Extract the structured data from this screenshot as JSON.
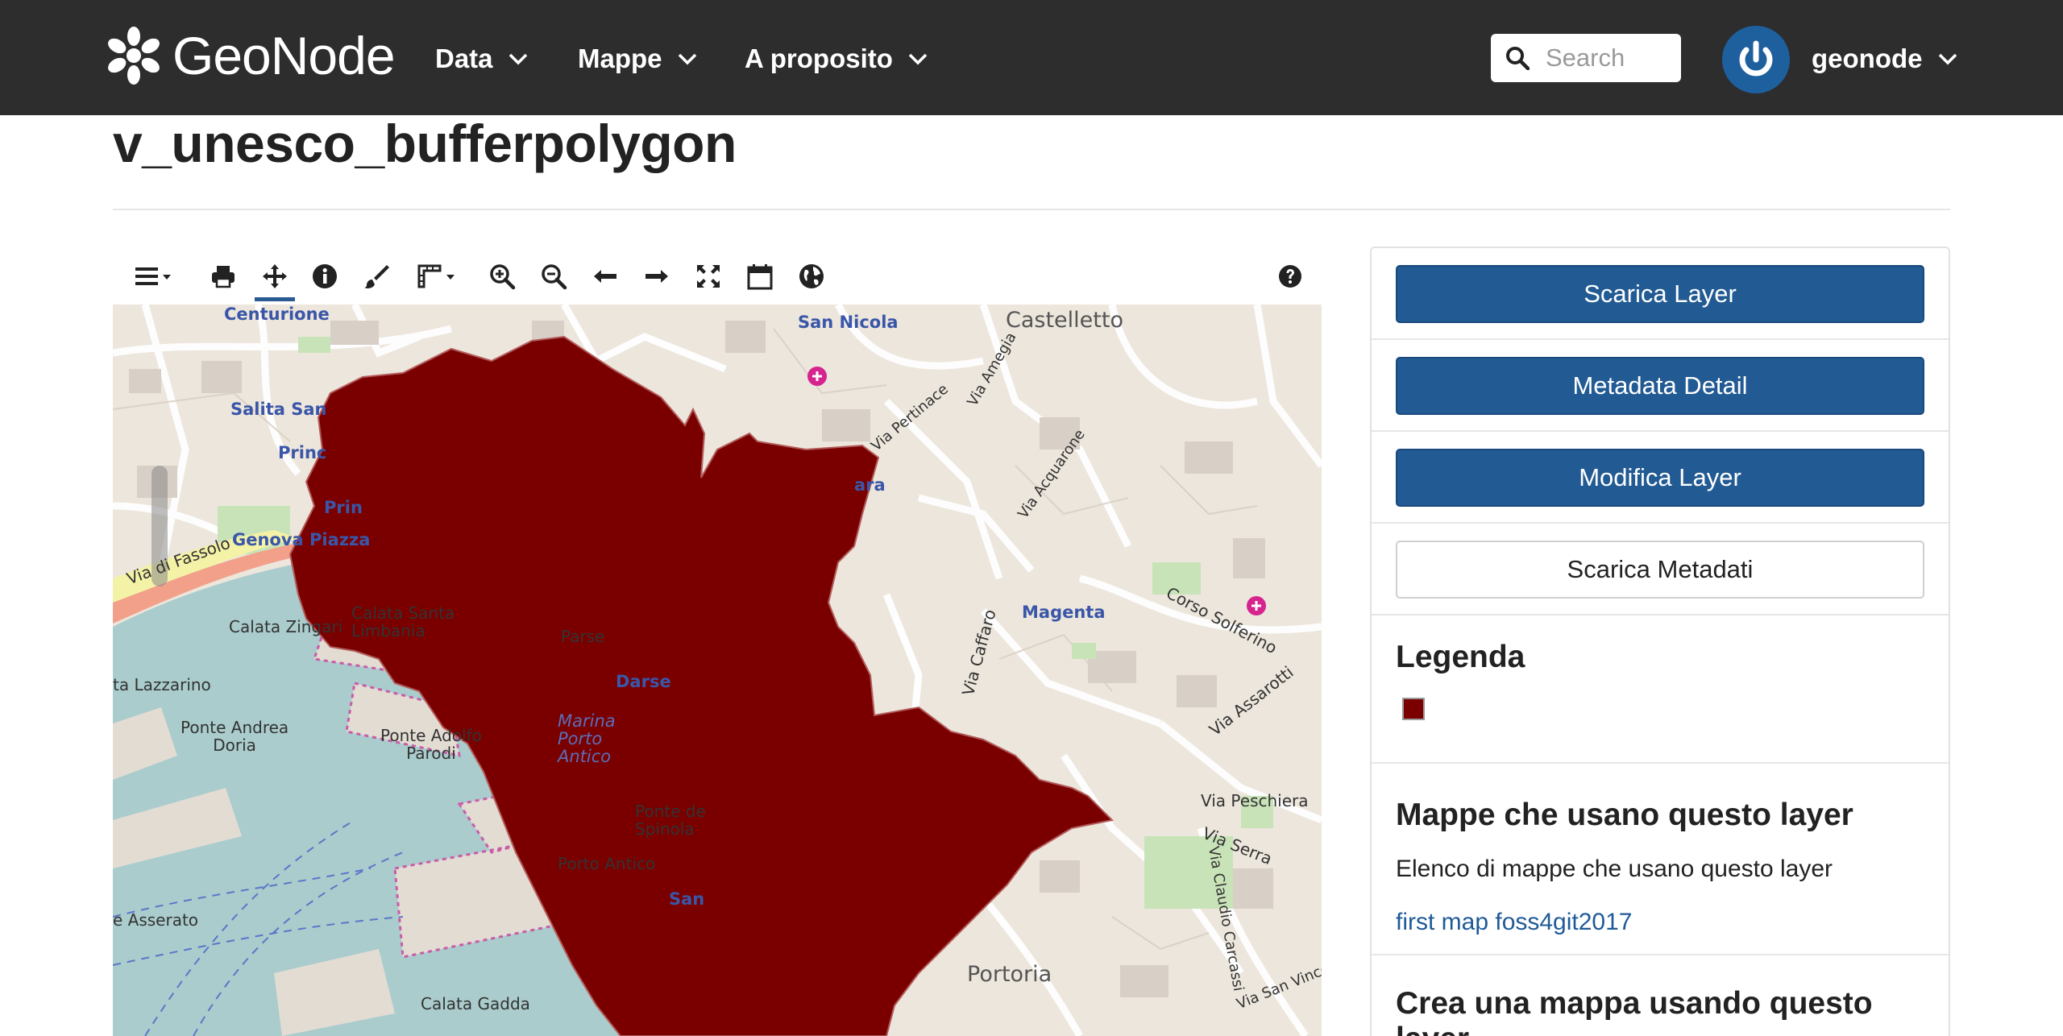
{
  "navbar": {
    "brand": "GeoNode",
    "menu": [
      {
        "label": "Data"
      },
      {
        "label": "Mappe"
      },
      {
        "label": "A proposito"
      }
    ],
    "search_placeholder": "Search",
    "user_name": "geonode"
  },
  "page": {
    "title": "v_unesco_bufferpolygon"
  },
  "map": {
    "labels": {
      "centurione": "Centurione",
      "san_nicola": "San Nicola",
      "castelletto": "Castelletto",
      "salita_san": "Salita San",
      "princ": "Princ",
      "prin": "Prin",
      "genova_piazza": "Genova Piazza",
      "via_di_fassolo": "Via di Fassolo",
      "calata_zingari": "Calata Zingari",
      "calata_santa_limbania": "Calata Santa\nLimbania",
      "ta_lazzarino": "ta Lazzarino",
      "ponte_andrea_doria": "Ponte Andrea\nDoria",
      "ponte_adolfo_parodi": "Ponte Adolfo\nParodi",
      "marina_porto_antico": "Marina\nPorto\nAntico",
      "ponte_de_spinola": "Ponte de\nSpinola",
      "porto_antico": "Porto Antico",
      "e_asserato": "e Asserato",
      "calata_gadda": "Calata Gadda",
      "magenta": "Magenta",
      "portoria": "Portoria",
      "via_caffaro": "Via Caffaro",
      "corso_solferino": "Corso Solferino",
      "via_assarotti": "Via Assarotti",
      "via_peschiera": "Via Peschiera",
      "via_serra": "Via Serra",
      "via_claudio_carcassi": "Via Claudio Carcassi",
      "via_san_vincenzo": "Via San Vincenzo",
      "ara": "ara",
      "darsena": "Darse",
      "parse": "Parse",
      "san": "San",
      "via_acquarone": "Via Acquarone",
      "via_pertinace": "Via Pertinace",
      "via_amegia": "Via Amegia"
    }
  },
  "sidebar": {
    "buttons": {
      "download_layer": "Scarica Layer",
      "metadata_detail": "Metadata Detail",
      "edit_layer": "Modifica Layer",
      "download_metadata": "Scarica Metadati"
    },
    "legend_title": "Legenda",
    "legend_color": "#7a0000",
    "maps_title": "Mappe che usano questo layer",
    "maps_subtitle": "Elenco di mappe che usano questo layer",
    "maps": [
      {
        "label": "first map foss4git2017"
      }
    ],
    "create_map_title": "Crea una mappa usando questo layer"
  },
  "colors": {
    "navbar": "#2d2d2d",
    "primary_button": "#225a93",
    "link": "#1f5a98",
    "polygon": "#7a0000",
    "sea": "#a9cbcb"
  }
}
